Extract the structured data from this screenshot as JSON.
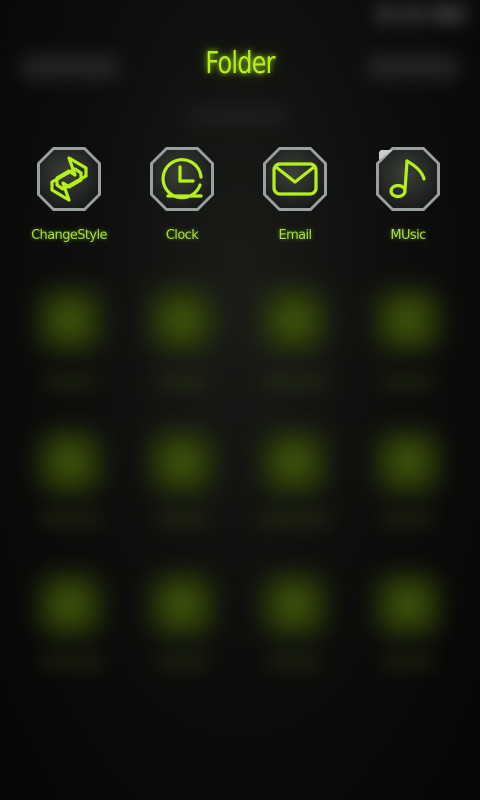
{
  "folder": {
    "title": "Folder",
    "apps": [
      {
        "label": "ChangeStyle",
        "icon": "change-style-icon"
      },
      {
        "label": "Clock",
        "icon": "clock-icon"
      },
      {
        "label": "Email",
        "icon": "email-icon"
      },
      {
        "label": "MUsic",
        "icon": "music-note-icon"
      }
    ]
  },
  "theme": {
    "accent": "#b6f01b",
    "background": "#0b0c0a",
    "tile": "#2a2e2a"
  }
}
